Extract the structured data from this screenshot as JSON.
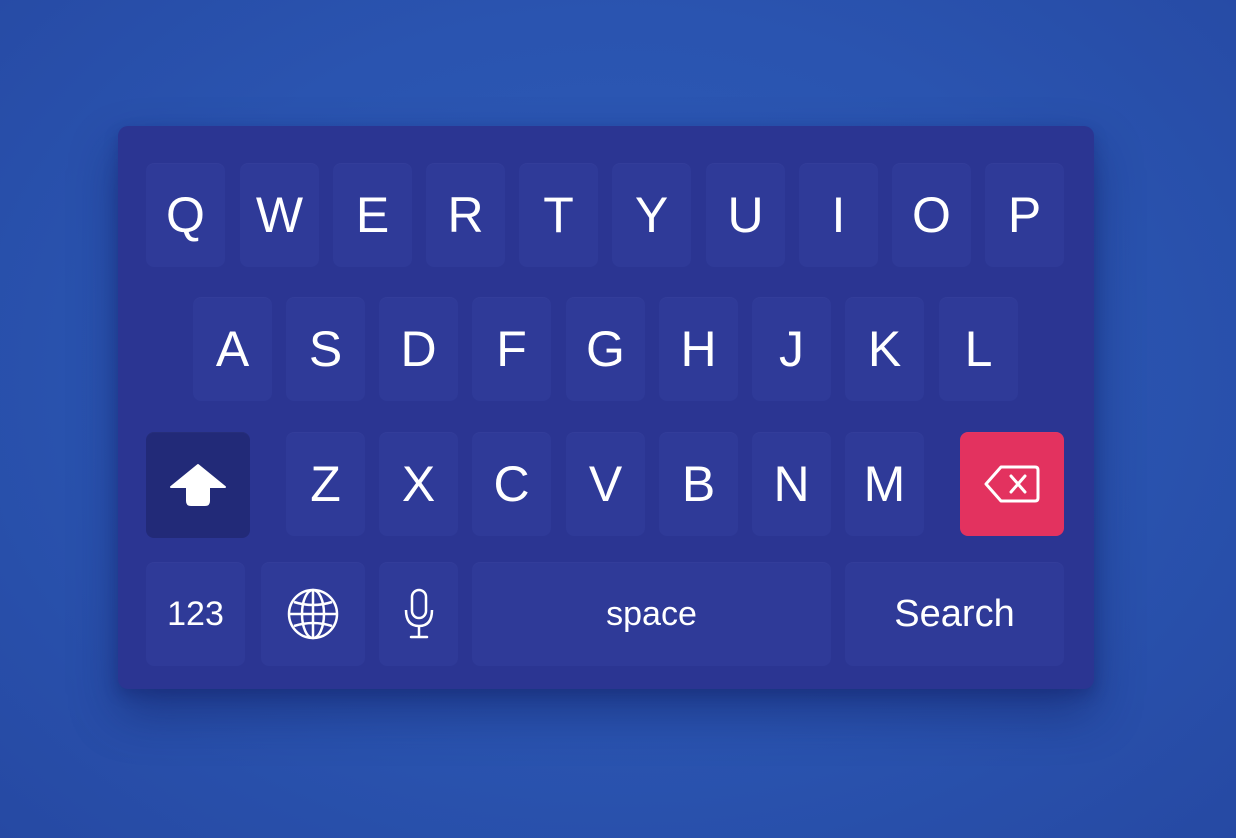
{
  "keyboard": {
    "row1": [
      "Q",
      "W",
      "E",
      "R",
      "T",
      "Y",
      "U",
      "I",
      "O",
      "P"
    ],
    "row2": [
      "A",
      "S",
      "D",
      "F",
      "G",
      "H",
      "J",
      "K",
      "L"
    ],
    "row3": [
      "Z",
      "X",
      "C",
      "V",
      "B",
      "N",
      "M"
    ],
    "shift_icon": "shift-arrow-icon",
    "backspace_icon": "backspace-icon",
    "numbers_label": "123",
    "globe_icon": "globe-icon",
    "mic_icon": "microphone-icon",
    "space_label": "space",
    "search_label": "Search"
  },
  "colors": {
    "background": "#2a54b0",
    "keyboard": "#2b3592",
    "key": "#2f3a98",
    "shift_key": "#222a78",
    "backspace_key": "#e3325f",
    "text": "#ffffff"
  }
}
